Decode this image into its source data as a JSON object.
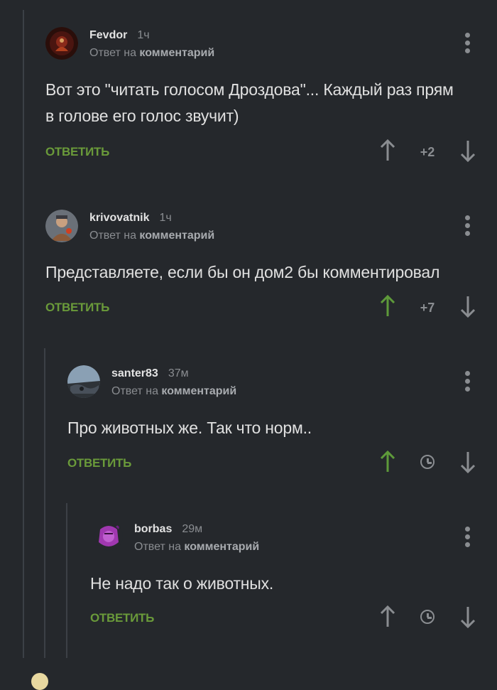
{
  "comments": [
    {
      "username": "Fevdor",
      "time": "1ч",
      "reply_prefix": "Ответ на",
      "reply_target": "комментарий",
      "text": "Вот это \"читать голосом Дроздова\"... Каждый раз прям в голове его голос звучит)",
      "reply_label": "ОТВЕТИТЬ",
      "rating": "+2",
      "upvoted": false
    },
    {
      "username": "krivovatnik",
      "time": "1ч",
      "reply_prefix": "Ответ на",
      "reply_target": "комментарий",
      "text": "Представляете, если бы он дом2 бы комментировал",
      "reply_label": "ОТВЕТИТЬ",
      "rating": "+7",
      "upvoted": true
    },
    {
      "username": "santer83",
      "time": "37м",
      "reply_prefix": "Ответ на",
      "reply_target": "комментарий",
      "text": "Про животных же. Так что норм..",
      "reply_label": "ОТВЕТИТЬ",
      "upvoted": true
    },
    {
      "username": "borbas",
      "time": "29м",
      "reply_prefix": "Ответ на",
      "reply_target": "комментарий",
      "text": "Не надо так о животных.",
      "reply_label": "ОТВЕТИТЬ",
      "upvoted": false
    }
  ],
  "colors": {
    "background": "#25282c",
    "accent_green": "#6a9a3a",
    "upvote_active": "#5e9a3a",
    "icon_gray": "#8a8d91"
  }
}
